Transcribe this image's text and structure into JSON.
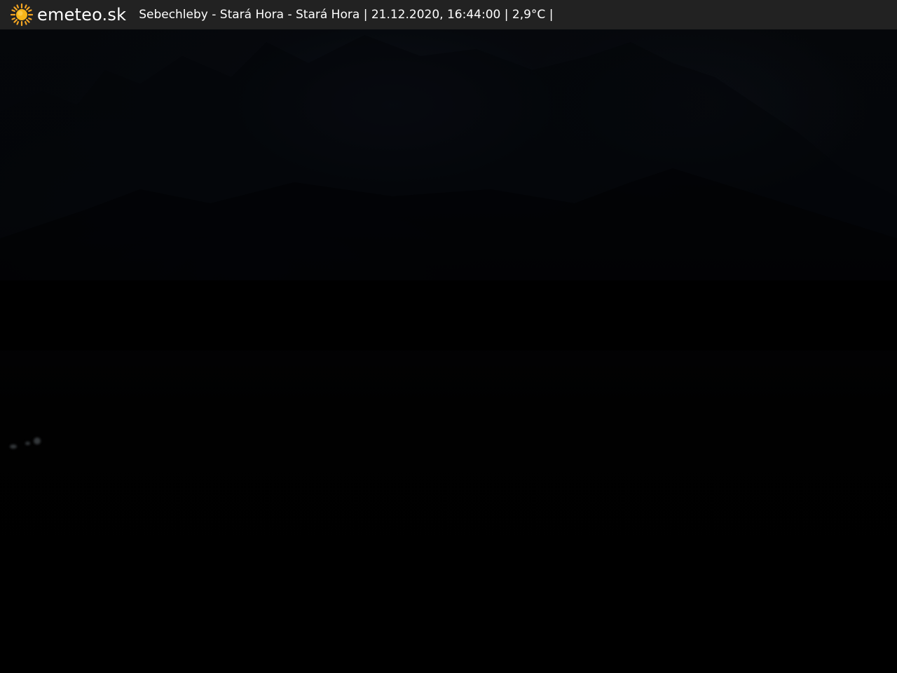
{
  "header": {
    "brand": "emeteo.sk",
    "logo_icon": "sun-icon",
    "location": "Sebechleby - Stará Hora - Stará Hora",
    "separator": "|",
    "datetime": "21.12.2020, 16:44:00",
    "temperature": "2,9°C"
  },
  "colors": {
    "topbar_background": "#222222",
    "text": "#ffffff",
    "sun_core": "#f7b519",
    "sun_rays": "#f5a623",
    "image_background": "#000000"
  }
}
